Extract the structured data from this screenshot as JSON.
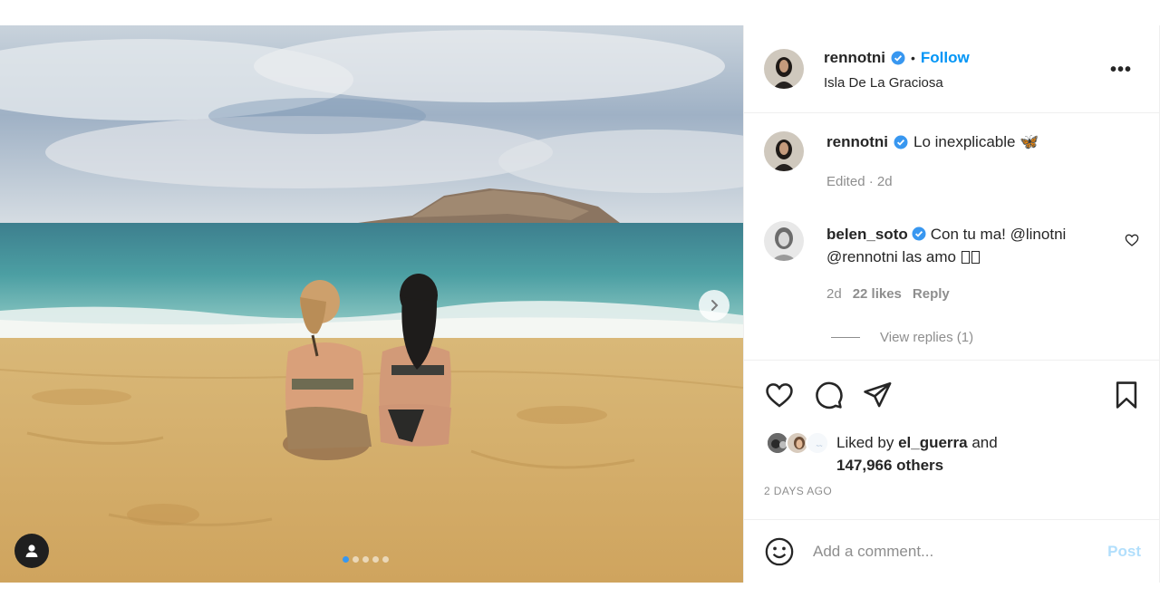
{
  "post": {
    "author": {
      "username": "rennotni",
      "verified": true,
      "follow_label": "Follow",
      "location": "Isla De La Graciosa"
    },
    "more_label": "•••",
    "separator": "•",
    "caption": {
      "username": "rennotni",
      "text": "Lo inexplicable 🦋",
      "meta": "Edited · 2d"
    },
    "comments": [
      {
        "username": "belen_soto",
        "verified": true,
        "text": "Con tu ma! @linotni @rennotni las amo ",
        "age": "2d",
        "likes": "22 likes",
        "reply_label": "Reply",
        "view_replies": "View replies (1)"
      }
    ],
    "likes": {
      "prefix": "Liked by",
      "user": "el_guerra",
      "connector": "and",
      "others": "147,966 others"
    },
    "date": "2 DAYS AGO",
    "add_comment": {
      "placeholder": "Add a comment...",
      "post_label": "Post"
    },
    "carousel": {
      "total": 5,
      "current": 1
    }
  },
  "icons": {
    "like": "heart-icon",
    "comment": "comment-icon",
    "share": "send-icon",
    "save": "bookmark-icon",
    "emoji": "smiley-icon",
    "tags": "user-icon",
    "next": "chevron-right-icon"
  },
  "colors": {
    "accent": "#0095f6",
    "post_disabled": "#b2dffc",
    "muted": "#8e8e8e",
    "verified": "#3897f0"
  }
}
